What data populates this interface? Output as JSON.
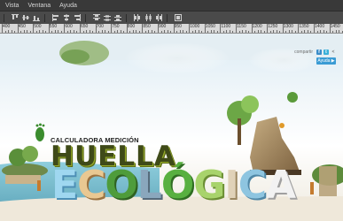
{
  "menu": [
    "Vista",
    "Ventana",
    "Ayuda"
  ],
  "toolbar": {
    "buttons": [
      "align-top-icon",
      "align-middle-icon",
      "align-bottom-icon",
      "distribute-left-icon",
      "distribute-center-icon",
      "distribute-right-icon",
      "align-left-icon",
      "align-hcenter-icon",
      "align-right-icon",
      "distribute-top-icon",
      "distribute-vcenter-icon",
      "distribute-bottom-icon",
      "auto-align-icon"
    ]
  },
  "ruler": {
    "labels": [
      "400",
      "450",
      "500",
      "550",
      "600",
      "650",
      "700",
      "750",
      "800",
      "850",
      "900",
      "950",
      "1000",
      "1050",
      "1100",
      "1150",
      "1200",
      "1250",
      "1300",
      "1350",
      "1400",
      "1450"
    ]
  },
  "page": {
    "share_label": "compartir",
    "help_label": "Ayuda ▶",
    "title_small": "CALCULADORA MEDICIÓN",
    "title_big": "HUELLA",
    "title_3d": "ECOLÓGICA"
  },
  "colors": {
    "menubar": "#393939",
    "toolbar": "#4a4a4a",
    "ruler": "#d9d9d9",
    "accent_blue": "#3a9bd4",
    "title_green": "#3f4a18"
  }
}
